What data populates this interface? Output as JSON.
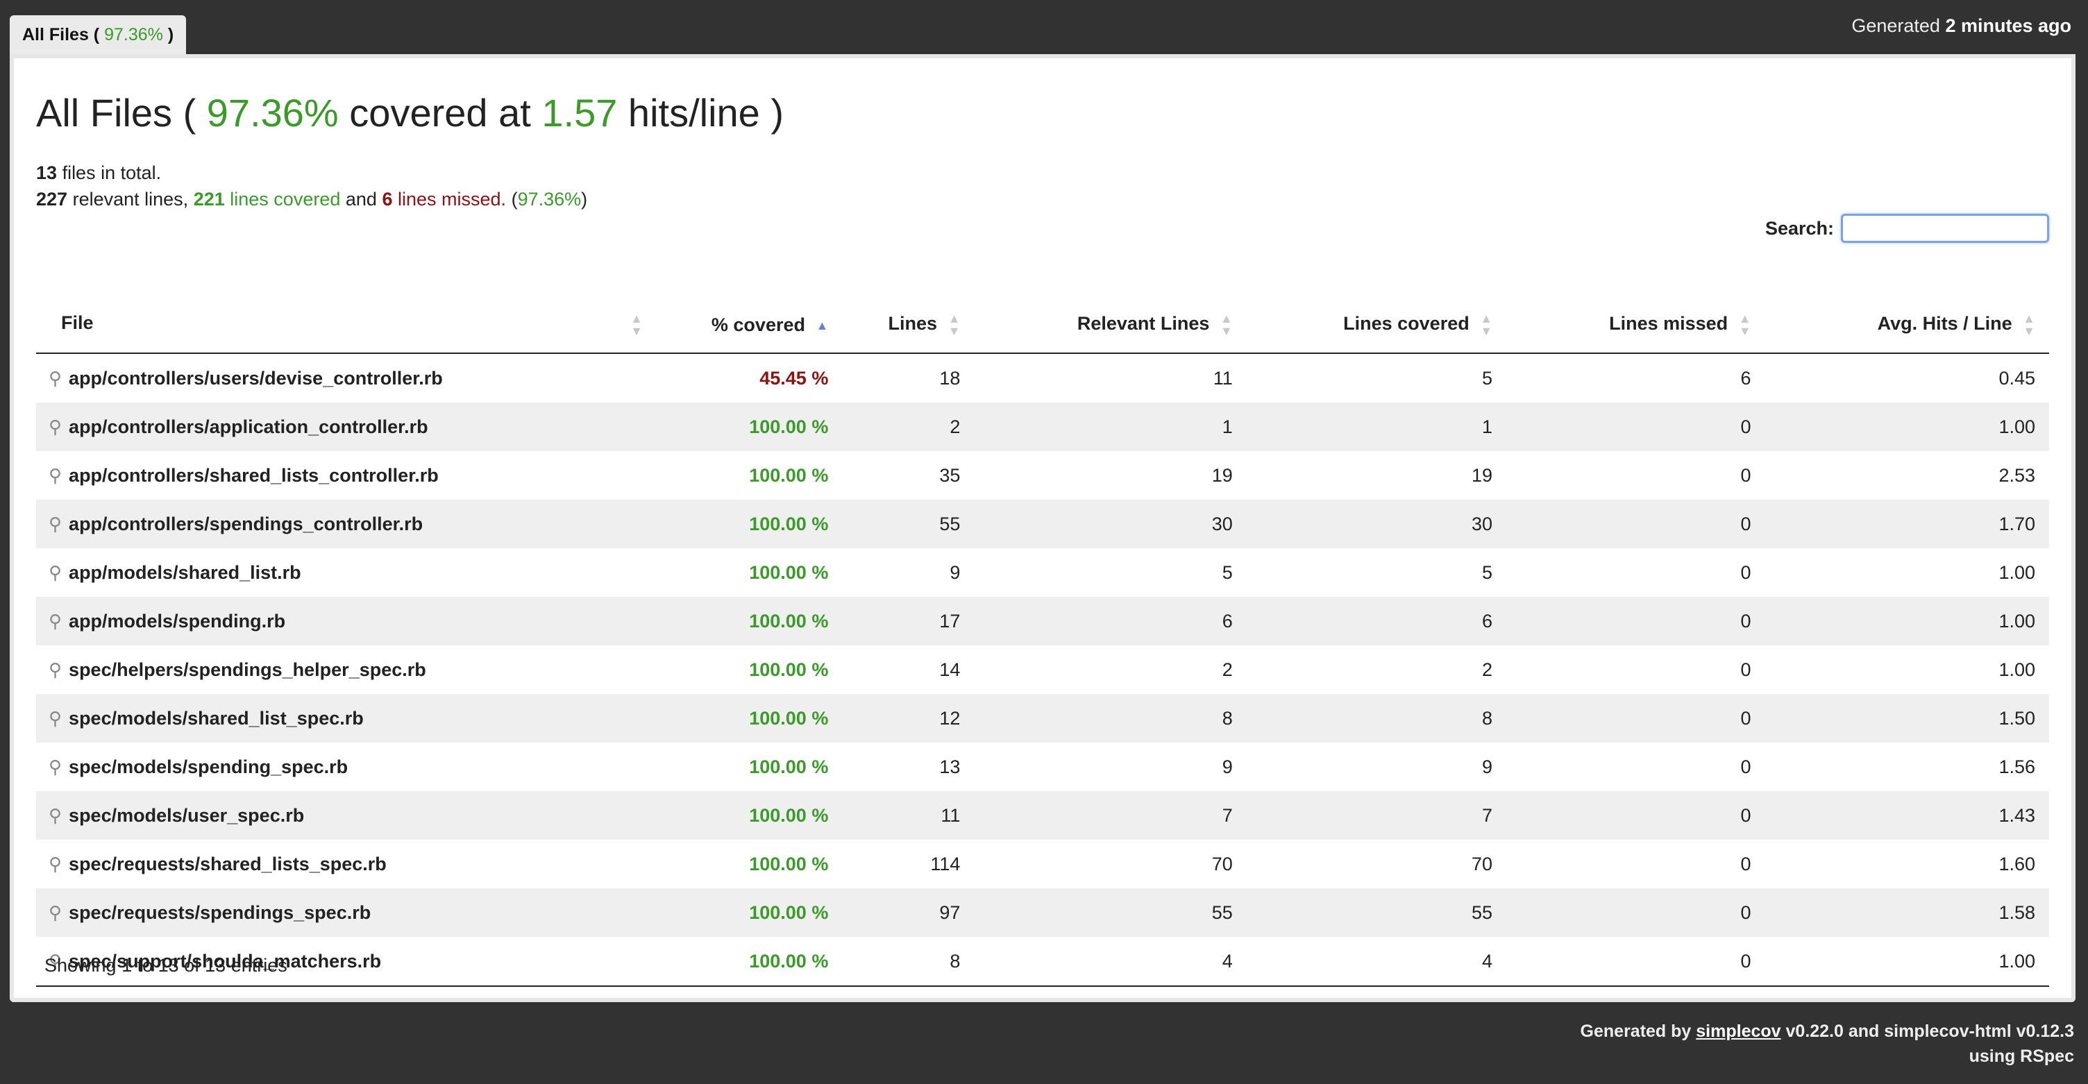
{
  "tab": {
    "label": "All Files (",
    "pct": "97.36%",
    "close": ")"
  },
  "header": {
    "generated_prefix": "Generated",
    "generated_time": "2 minutes ago"
  },
  "title": {
    "prefix": "All Files (",
    "pct": "97.36%",
    "mid": "covered at",
    "hits": "1.57",
    "suffix": "hits/line )"
  },
  "summary": {
    "file_count": "13",
    "file_text": "files in total.",
    "relevant": "227",
    "relevant_text": "relevant lines,",
    "covered": "221",
    "covered_text": "lines covered",
    "and_text": "and",
    "missed": "6",
    "missed_text": "lines missed.",
    "pct_open": "(",
    "pct": "97.36%",
    "pct_close": ")"
  },
  "search": {
    "label": "Search:",
    "value": ""
  },
  "columns": [
    "File",
    "% covered",
    "Lines",
    "Relevant Lines",
    "Lines covered",
    "Lines missed",
    "Avg. Hits / Line"
  ],
  "rows": [
    {
      "file": "app/controllers/users/devise_controller.rb",
      "covered": "45.45 %",
      "lines": "18",
      "relevant": "11",
      "lines_covered": "5",
      "missed": "6",
      "avg": "0.45",
      "status": "red"
    },
    {
      "file": "app/controllers/application_controller.rb",
      "covered": "100.00 %",
      "lines": "2",
      "relevant": "1",
      "lines_covered": "1",
      "missed": "0",
      "avg": "1.00",
      "status": "green"
    },
    {
      "file": "app/controllers/shared_lists_controller.rb",
      "covered": "100.00 %",
      "lines": "35",
      "relevant": "19",
      "lines_covered": "19",
      "missed": "0",
      "avg": "2.53",
      "status": "green"
    },
    {
      "file": "app/controllers/spendings_controller.rb",
      "covered": "100.00 %",
      "lines": "55",
      "relevant": "30",
      "lines_covered": "30",
      "missed": "0",
      "avg": "1.70",
      "status": "green"
    },
    {
      "file": "app/models/shared_list.rb",
      "covered": "100.00 %",
      "lines": "9",
      "relevant": "5",
      "lines_covered": "5",
      "missed": "0",
      "avg": "1.00",
      "status": "green"
    },
    {
      "file": "app/models/spending.rb",
      "covered": "100.00 %",
      "lines": "17",
      "relevant": "6",
      "lines_covered": "6",
      "missed": "0",
      "avg": "1.00",
      "status": "green"
    },
    {
      "file": "spec/helpers/spendings_helper_spec.rb",
      "covered": "100.00 %",
      "lines": "14",
      "relevant": "2",
      "lines_covered": "2",
      "missed": "0",
      "avg": "1.00",
      "status": "green"
    },
    {
      "file": "spec/models/shared_list_spec.rb",
      "covered": "100.00 %",
      "lines": "12",
      "relevant": "8",
      "lines_covered": "8",
      "missed": "0",
      "avg": "1.50",
      "status": "green"
    },
    {
      "file": "spec/models/spending_spec.rb",
      "covered": "100.00 %",
      "lines": "13",
      "relevant": "9",
      "lines_covered": "9",
      "missed": "0",
      "avg": "1.56",
      "status": "green"
    },
    {
      "file": "spec/models/user_spec.rb",
      "covered": "100.00 %",
      "lines": "11",
      "relevant": "7",
      "lines_covered": "7",
      "missed": "0",
      "avg": "1.43",
      "status": "green"
    },
    {
      "file": "spec/requests/shared_lists_spec.rb",
      "covered": "100.00 %",
      "lines": "114",
      "relevant": "70",
      "lines_covered": "70",
      "missed": "0",
      "avg": "1.60",
      "status": "green"
    },
    {
      "file": "spec/requests/spendings_spec.rb",
      "covered": "100.00 %",
      "lines": "97",
      "relevant": "55",
      "lines_covered": "55",
      "missed": "0",
      "avg": "1.58",
      "status": "green"
    },
    {
      "file": "spec/support/shoulda_matchers.rb",
      "covered": "100.00 %",
      "lines": "8",
      "relevant": "4",
      "lines_covered": "4",
      "missed": "0",
      "avg": "1.00",
      "status": "green"
    }
  ],
  "showing": "Showing 1 to 13 of 13 entries",
  "footer": {
    "prefix": "Generated by",
    "link": "simplecov",
    "version": "v0.22.0 and simplecov-html v0.12.3",
    "line2": "using RSpec"
  },
  "colors": {
    "covered": "#3b9a2a",
    "missed": "#8a1212",
    "background": "#323232"
  },
  "icons": {
    "file_row": "magnifier-icon",
    "sort": "sort-arrows-icon"
  }
}
